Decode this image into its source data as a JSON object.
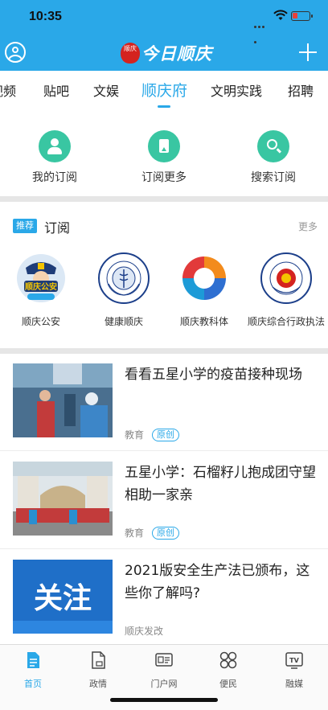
{
  "status_bar": {
    "time": "10:35"
  },
  "app": {
    "title": "今日顺庆",
    "seal_text": "顺庆",
    "accent": "#2aa8e8",
    "action_color": "#39c6a2"
  },
  "tabs": [
    {
      "label": "视频",
      "active": false
    },
    {
      "label": "贴吧",
      "active": false
    },
    {
      "label": "文娱",
      "active": false
    },
    {
      "label": "顺庆府",
      "active": true
    },
    {
      "label": "文明实践",
      "active": false
    },
    {
      "label": "招聘",
      "active": false
    }
  ],
  "actions": [
    {
      "label": "我的订阅",
      "icon": "user-icon"
    },
    {
      "label": "订阅更多",
      "icon": "bookmark-icon"
    },
    {
      "label": "搜索订阅",
      "icon": "search-icon"
    }
  ],
  "recommend": {
    "badge": "推荐",
    "title": "订阅",
    "more": "更多",
    "accounts": [
      {
        "name": "顺庆公安",
        "emblem_text": "顺庆公安"
      },
      {
        "name": "健康顺庆",
        "emblem_text": "南充市顺庆区卫生健康局"
      },
      {
        "name": "顺庆教科体",
        "emblem_text": ""
      },
      {
        "name": "顺庆综合行政执法",
        "emblem_text": "顺庆区综合行政执法局"
      }
    ]
  },
  "news": [
    {
      "headline": "看看五星小学的疫苗接种现场",
      "category": "教育",
      "tag": "原创"
    },
    {
      "headline": "五星小学：石榴籽儿抱成团守望相助一家亲",
      "category": "教育",
      "tag": "原创"
    },
    {
      "headline": "2021版安全生产法已颁布，这些你了解吗?",
      "category": "顺庆发改",
      "tag": "",
      "thumb_text": "关注"
    }
  ],
  "bottom_tabs": [
    {
      "label": "首页",
      "icon": "home-doc-icon",
      "active": true
    },
    {
      "label": "政情",
      "icon": "government-doc-icon",
      "active": false
    },
    {
      "label": "门户网",
      "icon": "portal-icon",
      "active": false
    },
    {
      "label": "便民",
      "icon": "service-grid-icon",
      "active": false
    },
    {
      "label": "融媒",
      "icon": "tv-icon",
      "active": false
    }
  ]
}
